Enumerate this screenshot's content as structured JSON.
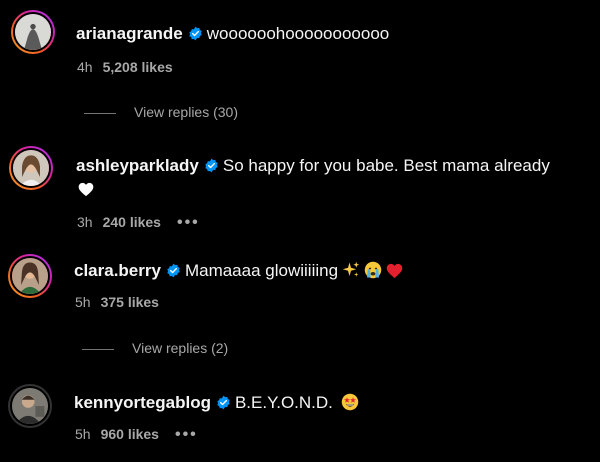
{
  "comments": [
    {
      "username": "arianagrande",
      "text": "woooooohooooooooooo",
      "time": "4h",
      "likes": "5,208 likes",
      "replies": "View replies (30)"
    },
    {
      "username": "ashleyparklady",
      "text": "So happy for you babe. Best mama already",
      "time": "3h",
      "likes": "240 likes",
      "more": "•••"
    },
    {
      "username": "clara.berry",
      "text": "Mamaaaa glowiiiiing",
      "time": "5h",
      "likes": "375 likes",
      "replies": "View replies (2)"
    },
    {
      "username": "kennyortegablog",
      "text": "B.E.Y.O.N.D.",
      "time": "5h",
      "likes": "960 likes",
      "more": "•••"
    }
  ],
  "icons": {
    "verified_color": "#0095f6",
    "emoji": [
      "white-heart-emoji",
      "sparkles-emoji",
      "crying-face-emoji",
      "red-heart-emoji",
      "star-struck-emoji"
    ]
  }
}
